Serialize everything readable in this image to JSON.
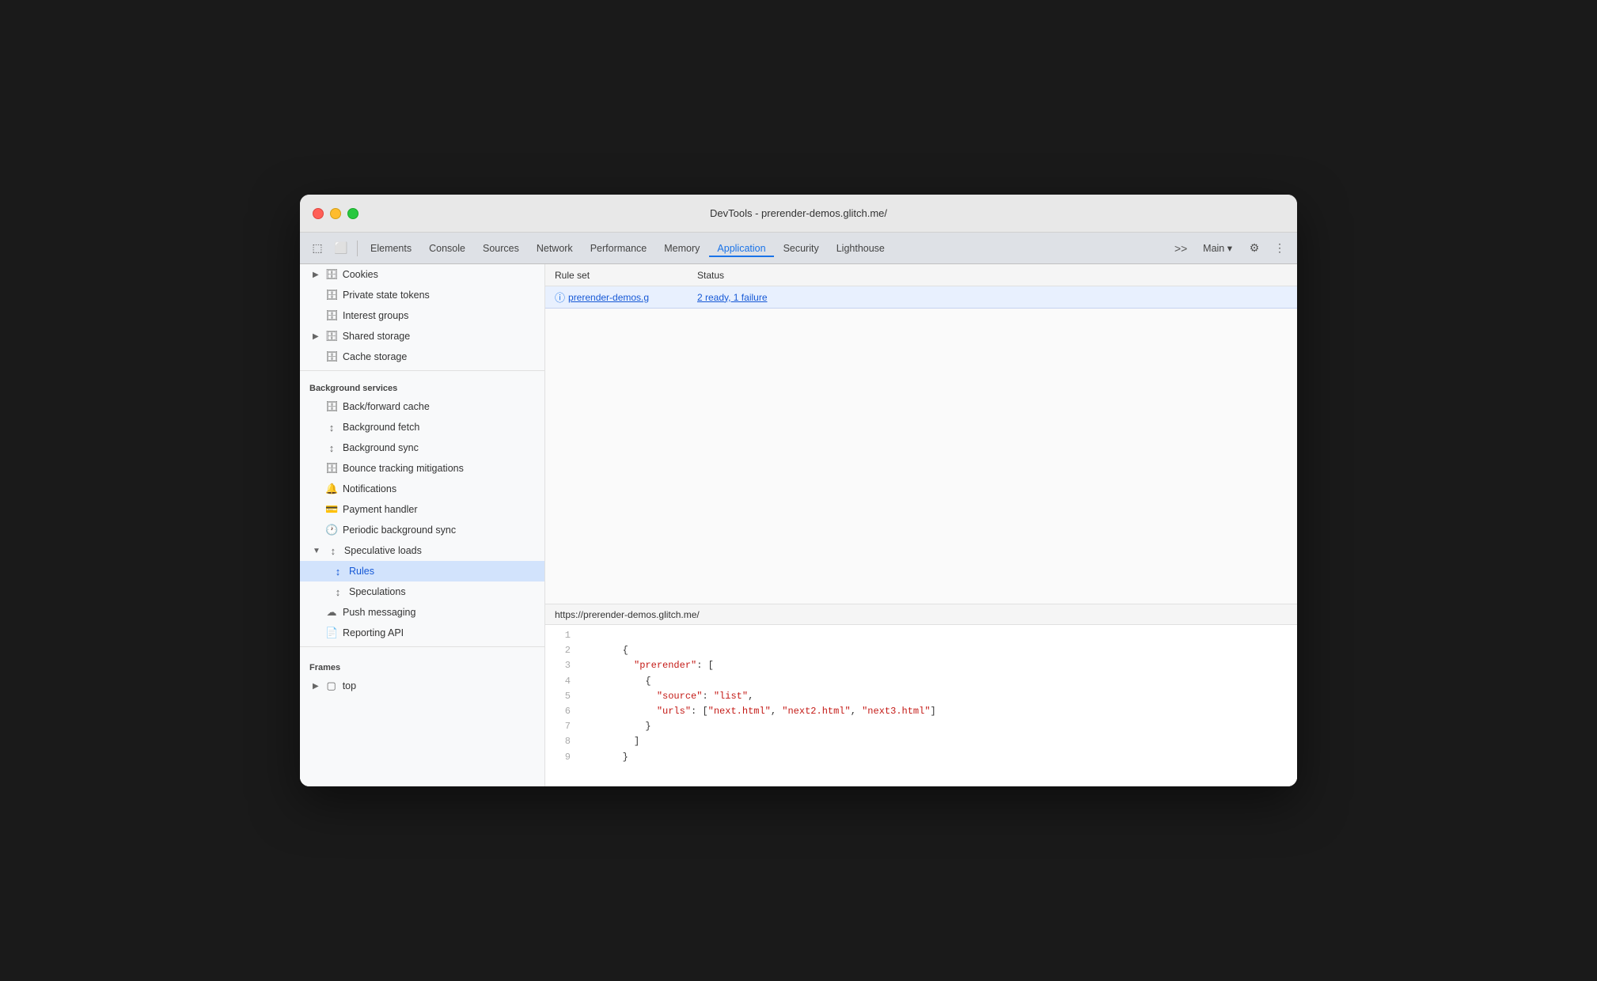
{
  "window": {
    "title": "DevTools - prerender-demos.glitch.me/"
  },
  "tabs": {
    "items": [
      {
        "label": "Elements",
        "active": false
      },
      {
        "label": "Console",
        "active": false
      },
      {
        "label": "Sources",
        "active": false
      },
      {
        "label": "Network",
        "active": false
      },
      {
        "label": "Performance",
        "active": false
      },
      {
        "label": "Memory",
        "active": false
      },
      {
        "label": "Application",
        "active": true
      },
      {
        "label": "Security",
        "active": false
      },
      {
        "label": "Lighthouse",
        "active": false
      }
    ],
    "more_label": ">>",
    "main_label": "Main",
    "settings_label": "⚙"
  },
  "sidebar": {
    "sections": [
      {
        "name": "storage-section",
        "items": [
          {
            "label": "Cookies",
            "icon": "▶ 🗄",
            "indent": 0
          },
          {
            "label": "Private state tokens",
            "icon": "🗄",
            "indent": 0
          },
          {
            "label": "Interest groups",
            "icon": "🗄",
            "indent": 0
          },
          {
            "label": "Shared storage",
            "icon": "▶ 🗄",
            "indent": 0
          },
          {
            "label": "Cache storage",
            "icon": "🗄",
            "indent": 0
          }
        ]
      },
      {
        "name": "background-services",
        "header": "Background services",
        "items": [
          {
            "label": "Back/forward cache",
            "icon": "🗄",
            "indent": 0
          },
          {
            "label": "Background fetch",
            "icon": "↕",
            "indent": 0
          },
          {
            "label": "Background sync",
            "icon": "↕",
            "indent": 0
          },
          {
            "label": "Bounce tracking mitigations",
            "icon": "🗄",
            "indent": 0
          },
          {
            "label": "Notifications",
            "icon": "🔔",
            "indent": 0
          },
          {
            "label": "Payment handler",
            "icon": "💳",
            "indent": 0
          },
          {
            "label": "Periodic background sync",
            "icon": "🕐",
            "indent": 0
          },
          {
            "label": "Speculative loads",
            "icon": "↕",
            "indent": 0,
            "expanded": true,
            "active_parent": true
          },
          {
            "label": "Rules",
            "icon": "↕",
            "indent": 1,
            "active": true
          },
          {
            "label": "Speculations",
            "icon": "↕",
            "indent": 1
          },
          {
            "label": "Push messaging",
            "icon": "☁",
            "indent": 0
          },
          {
            "label": "Reporting API",
            "icon": "📄",
            "indent": 0
          }
        ]
      },
      {
        "name": "frames",
        "header": "Frames",
        "items": [
          {
            "label": "top",
            "icon": "▶ ▢",
            "indent": 0
          }
        ]
      }
    ]
  },
  "main": {
    "table": {
      "columns": [
        "Rule set",
        "Status"
      ],
      "rows": [
        {
          "ruleset": "prerender-demos.g",
          "ruleset_full": "prerender-demos.glitch.me/",
          "status": "2 ready, 1 failure"
        }
      ]
    },
    "source_url": "https://prerender-demos.glitch.me/",
    "code": {
      "lines": [
        {
          "num": 1,
          "content": ""
        },
        {
          "num": 2,
          "content": "        {"
        },
        {
          "num": 3,
          "content": "          \"prerender\": ["
        },
        {
          "num": 4,
          "content": "            {"
        },
        {
          "num": 5,
          "content": "              \"source\": \"list\","
        },
        {
          "num": 6,
          "content": "              \"urls\": [\"next.html\", \"next2.html\", \"next3.html\"]"
        },
        {
          "num": 7,
          "content": "            }"
        },
        {
          "num": 8,
          "content": "          ]"
        },
        {
          "num": 9,
          "content": "        }"
        }
      ]
    }
  },
  "icons": {
    "inspector": "⬚",
    "device": "⬜",
    "more": ">>",
    "settings": "⚙",
    "kebab": "⋮",
    "arrow_right": "▶",
    "arrow_down": "▼",
    "circle_info": "ⓘ"
  }
}
